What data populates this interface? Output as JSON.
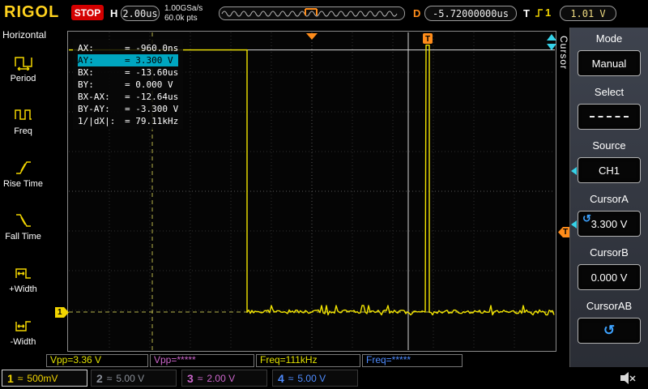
{
  "colors": {
    "accent_yellow": "#f2d500",
    "trace_yellow": "#f2e400",
    "orange": "#ff8c1a",
    "cyan": "#35d2e8",
    "magenta": "#cc66cc",
    "blue": "#4f8cff",
    "gray_channel": "#8a8f98",
    "red_stop": "#d40000",
    "highlight_teal": "#00a6c0"
  },
  "topbar": {
    "logo": "RIGOL",
    "run_state": "STOP",
    "h_label": "H",
    "timebase": "2.00us",
    "sample_rate": "1.00GSa/s",
    "mem_depth": "60.0k pts",
    "d_label": "D",
    "delay": "-5.72000000us",
    "t_label": "T",
    "trigger_source": "1",
    "trigger_level": "1.01 V"
  },
  "left_menu": {
    "title": "Horizontal",
    "items": [
      {
        "label": "Period",
        "icon": "period-icon"
      },
      {
        "label": "Freq",
        "icon": "freq-icon"
      },
      {
        "label": "Rise Time",
        "icon": "rise-time-icon"
      },
      {
        "label": "Fall Time",
        "icon": "fall-time-icon"
      },
      {
        "label": "+Width",
        "icon": "plus-width-icon"
      },
      {
        "label": "-Width",
        "icon": "minus-width-icon"
      }
    ]
  },
  "cursor_info": {
    "rows": [
      {
        "label": "AX:",
        "value": "= -960.0ns",
        "highlighted": false
      },
      {
        "label": "AY:",
        "value": "= 3.300 V",
        "highlighted": true
      },
      {
        "label": "BX:",
        "value": "= -13.60us",
        "highlighted": false
      },
      {
        "label": "BY:",
        "value": "= 0.000 V",
        "highlighted": false
      },
      {
        "label": "BX-AX:",
        "value": "= -12.64us",
        "highlighted": false
      },
      {
        "label": "BY-AY:",
        "value": "= -3.300 V",
        "highlighted": false
      },
      {
        "label": "1/|dX|:",
        "value": "= 79.11kHz",
        "highlighted": false
      }
    ]
  },
  "cursor_tab": "Cursor",
  "markers": {
    "ch1_label": "1",
    "trigger_label": "T"
  },
  "right_menu": {
    "rotate_icon": "↺",
    "sections": [
      {
        "label": "Mode",
        "value": "Manual"
      },
      {
        "label": "Select",
        "value": ""
      },
      {
        "label": "Source",
        "value": "CH1"
      },
      {
        "label": "CursorA",
        "value": "3.300 V"
      },
      {
        "label": "CursorB",
        "value": "0.000 V"
      },
      {
        "label": "CursorAB",
        "value": ""
      }
    ]
  },
  "measurements": [
    {
      "label": "Vpp=3.36 V",
      "color": "#e0e000"
    },
    {
      "label": "Vpp=*****",
      "color": "#cc66cc"
    },
    {
      "label": "Freq=111kHz",
      "color": "#e0e000"
    },
    {
      "label": "Freq=*****",
      "color": "#4f8cff"
    }
  ],
  "channels": [
    {
      "num": "1",
      "coupling": "≈",
      "scale": "500mV",
      "color": "#f2d500",
      "selected": true
    },
    {
      "num": "2",
      "coupling": "≈",
      "scale": "5.00 V",
      "color": "#8a8f98",
      "selected": false
    },
    {
      "num": "3",
      "coupling": "≈",
      "scale": "2.00 V",
      "color": "#cc66cc",
      "selected": false
    },
    {
      "num": "4",
      "coupling": "≈",
      "scale": "5.00 V",
      "color": "#4f8cff",
      "selected": false
    }
  ],
  "chart_data": {
    "type": "line",
    "title": "CH1 pulse waveform with cursors",
    "x_units": "us",
    "y_units": "V",
    "seconds_per_div": "2.00us",
    "volts_per_div": "500mV",
    "x_min_us": -17.72,
    "x_max_us": 6.28,
    "trigger_us": 0,
    "trigger_level_v": 1.01,
    "high_v": 3.3,
    "low_v": 0.0,
    "vpp_v": 3.36,
    "freq_khz": 111,
    "segments": [
      {
        "type": "high",
        "from_us": -17.72,
        "to_us": -8.92,
        "v": 3.3
      },
      {
        "type": "low_noisy",
        "from_us": -8.92,
        "to_us": -0.08,
        "v": 0.0
      },
      {
        "type": "pulse",
        "from_us": -0.08,
        "to_us": 0.08,
        "v": 3.36
      },
      {
        "type": "low_noisy",
        "from_us": 0.08,
        "to_us": 6.28,
        "v": 0.0
      }
    ],
    "cursor_a": {
      "x_us": -0.96,
      "y_v": 3.3
    },
    "cursor_b": {
      "x_us": -13.6,
      "y_v": 0.0
    }
  }
}
